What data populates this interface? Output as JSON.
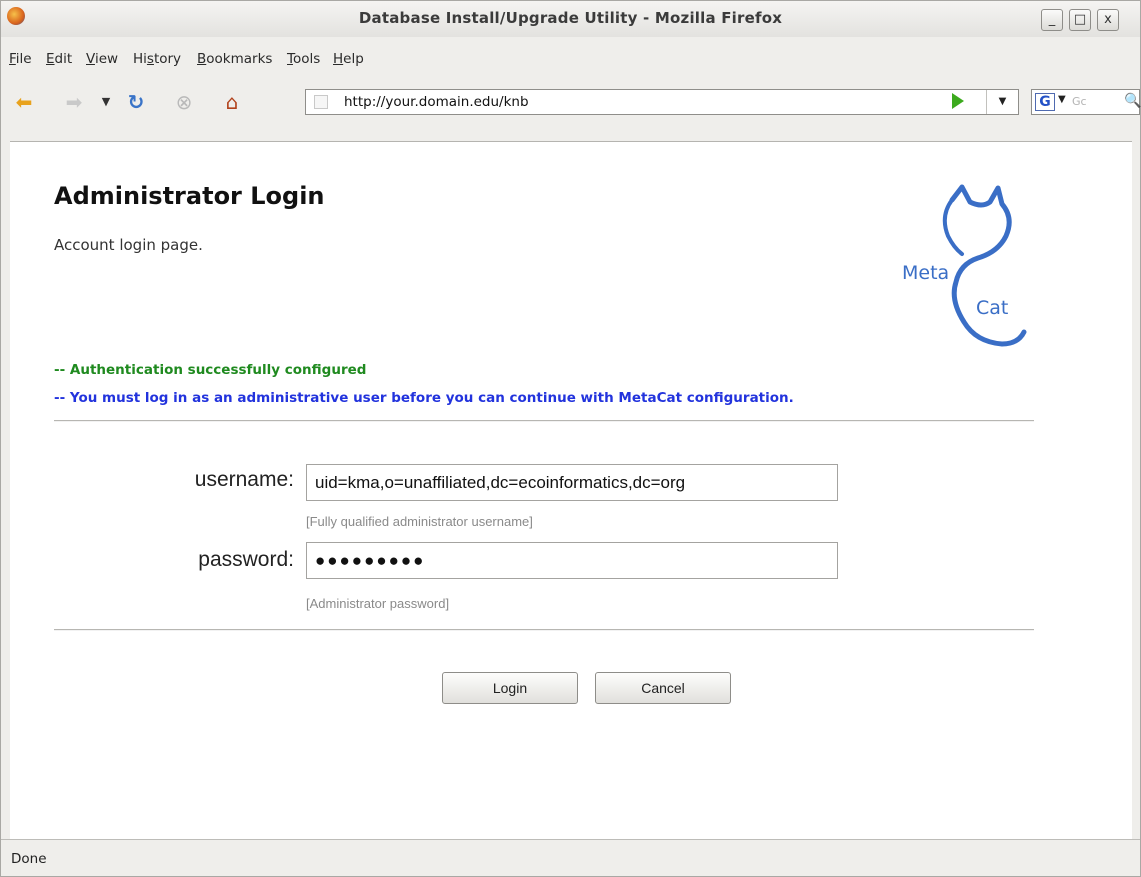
{
  "window": {
    "title": "Database Install/Upgrade Utility - Mozilla Firefox",
    "minimize": "_",
    "maximize": "□",
    "close": "x"
  },
  "menu": [
    {
      "label": "File",
      "key": "F",
      "rest": "ile"
    },
    {
      "label": "Edit",
      "key": "E",
      "rest": "dit"
    },
    {
      "label": "View",
      "key": "V",
      "rest": "iew"
    },
    {
      "label": "History",
      "pre": "Hi",
      "key": "s",
      "rest": "tory"
    },
    {
      "label": "Bookmarks",
      "key": "B",
      "rest": "ookmarks"
    },
    {
      "label": "Tools",
      "key": "T",
      "rest": "ools"
    },
    {
      "label": "Help",
      "key": "H",
      "rest": "elp"
    }
  ],
  "toolbar": {
    "url": "http://your.domain.edu/knb",
    "search_engine": "G",
    "search_placeholder": "Gc"
  },
  "page": {
    "heading": "Administrator Login",
    "subheading": "Account login page.",
    "logo_text_1": "Meta",
    "logo_text_2": "Cat",
    "msg_success": "-- Authentication successfully configured",
    "msg_info": "-- You must log in as an administrative user before you can continue with MetaCat configuration.",
    "username_label": "username:",
    "username_value": "uid=kma,o=unaffiliated,dc=ecoinformatics,dc=org",
    "username_help": "[Fully qualified administrator username]",
    "password_label": "password:",
    "password_value": "●●●●●●●●●",
    "password_help": "[Administrator password]",
    "login_button": "Login",
    "cancel_button": "Cancel"
  },
  "status": {
    "text": "Done"
  },
  "colors": {
    "success": "#1f8a1f",
    "info": "#2233dd",
    "logo": "#3a6ec6"
  }
}
